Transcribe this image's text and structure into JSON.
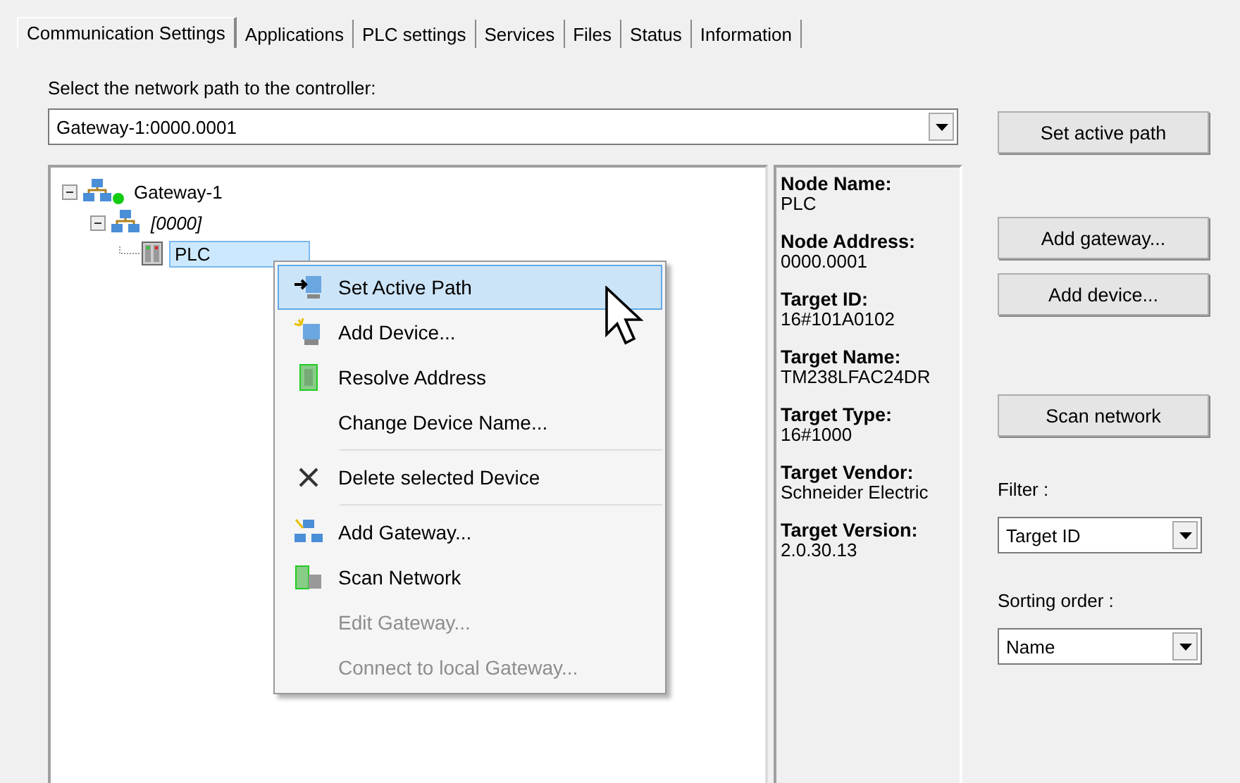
{
  "tabs": [
    {
      "label": "Communication Settings",
      "selected": true
    },
    {
      "label": "Applications",
      "selected": false
    },
    {
      "label": "PLC settings",
      "selected": false
    },
    {
      "label": "Services",
      "selected": false
    },
    {
      "label": "Files",
      "selected": false
    },
    {
      "label": "Status",
      "selected": false
    },
    {
      "label": "Information",
      "selected": false
    }
  ],
  "path_label": "Select the network path to the controller:",
  "path_combo": {
    "value": "Gateway-1:0000.0001"
  },
  "tree": [
    {
      "label": "Gateway-1",
      "italic": false,
      "selected": false,
      "expanded": true,
      "online": true,
      "kind": "gateway",
      "children": [
        {
          "label": "[0000]",
          "italic": true,
          "selected": false,
          "expanded": true,
          "online": false,
          "kind": "network",
          "children": [
            {
              "label": "PLC",
              "italic": false,
              "selected": true,
              "online": false,
              "kind": "device"
            }
          ]
        }
      ]
    }
  ],
  "info": [
    {
      "label": "Node Name:",
      "value": "PLC"
    },
    {
      "label": "Node Address:",
      "value": "0000.0001"
    },
    {
      "label": "Target ID:",
      "value": "16#101A0102"
    },
    {
      "label": "Target Name:",
      "value": "TM238LFAC24DR"
    },
    {
      "label": "Target Type:",
      "value": "16#1000"
    },
    {
      "label": "Target Vendor:",
      "value": "Schneider Electric"
    },
    {
      "label": "Target Version:",
      "value": "2.0.30.13"
    }
  ],
  "buttons": {
    "set_active": "Set active path",
    "add_gateway": "Add gateway...",
    "add_device": "Add device...",
    "scan": "Scan network"
  },
  "filter": {
    "label": "Filter :",
    "value": "Target ID"
  },
  "sorting": {
    "label": "Sorting order :",
    "value": "Name"
  },
  "context_menu": [
    {
      "kind": "item",
      "label": "Set Active Path",
      "selected": true,
      "disabled": false
    },
    {
      "kind": "item",
      "label": "Add Device...",
      "selected": false,
      "disabled": false
    },
    {
      "kind": "item",
      "label": "Resolve Address",
      "selected": false,
      "disabled": false
    },
    {
      "kind": "item",
      "label": "Change Device Name...",
      "selected": false,
      "disabled": false
    },
    {
      "kind": "separator"
    },
    {
      "kind": "item",
      "label": "Delete selected Device",
      "selected": false,
      "disabled": false
    },
    {
      "kind": "separator"
    },
    {
      "kind": "item",
      "label": "Add Gateway...",
      "selected": false,
      "disabled": false
    },
    {
      "kind": "item",
      "label": "Scan Network",
      "selected": false,
      "disabled": false
    },
    {
      "kind": "item",
      "label": "Edit Gateway...",
      "selected": false,
      "disabled": true
    },
    {
      "kind": "item",
      "label": "Connect to local Gateway...",
      "selected": false,
      "disabled": true
    }
  ]
}
